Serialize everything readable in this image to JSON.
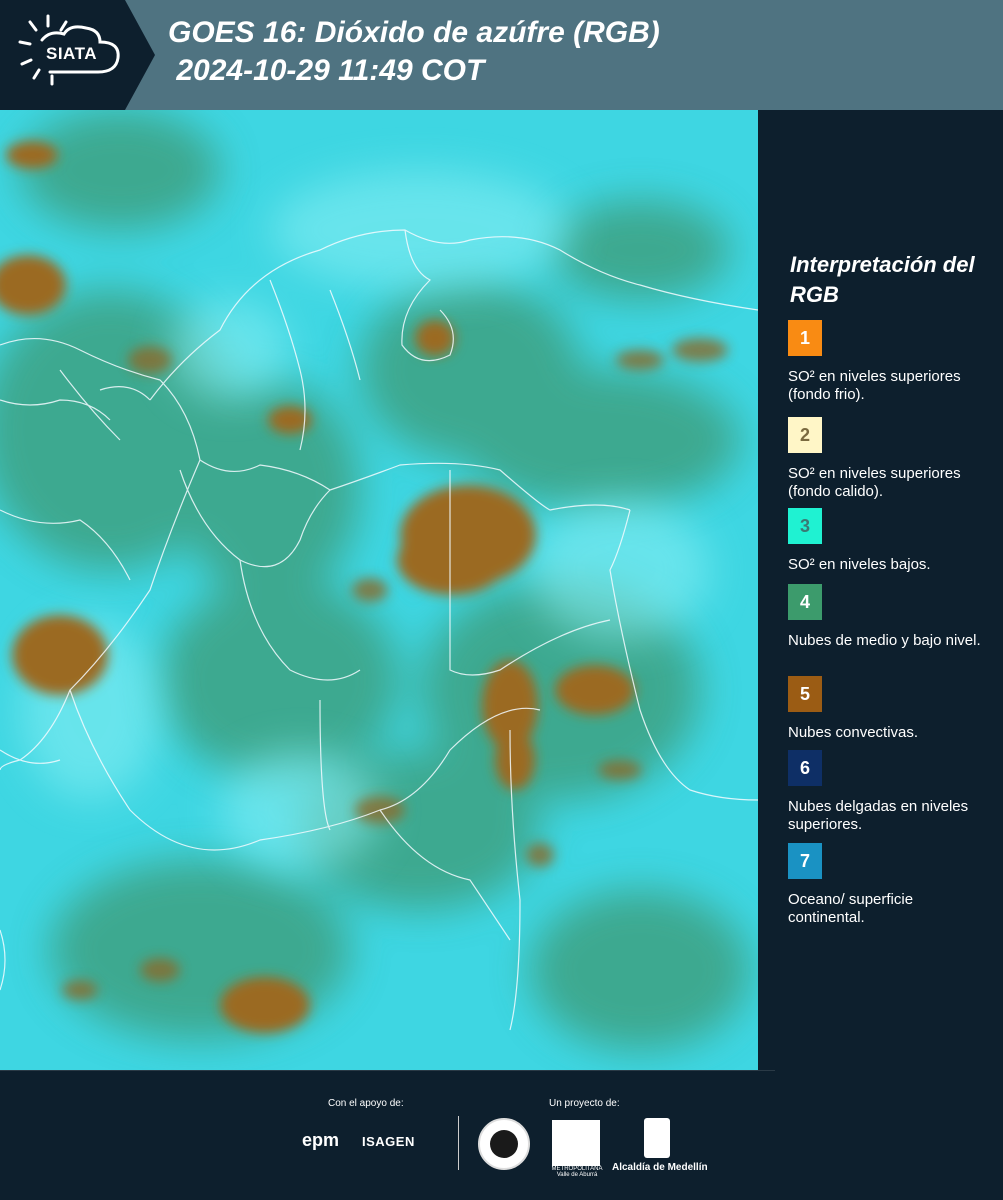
{
  "header": {
    "logo_text": "SIATA",
    "title_line1": "GOES 16: Dióxido de azúfre (RGB)",
    "title_line2": " 2024-10-29 11:49 COT"
  },
  "legend": {
    "title": "Interpretación del RGB",
    "items": [
      {
        "number": "1",
        "color": "#f98b13",
        "label": "SO² en niveles superiores (fondo frio)."
      },
      {
        "number": "2",
        "color": "#fff6c7",
        "label": "SO² en niveles superiores (fondo calido)."
      },
      {
        "number": "3",
        "color": "#1ff2d2",
        "label": "SO² en niveles bajos."
      },
      {
        "number": "4",
        "color": "#3c9b6c",
        "label": "Nubes de medio y bajo nivel."
      },
      {
        "number": "5",
        "color": "#9b5c14",
        "label": "Nubes convectivas."
      },
      {
        "number": "6",
        "color": "#0e2f66",
        "label": "Nubes delgadas en niveles superiores."
      },
      {
        "number": "7",
        "color": "#1a92c3",
        "label": "Oceano/ superficie continental."
      }
    ]
  },
  "footer": {
    "support_label": "Con el apoyo de:",
    "project_label": "Un proyecto de:",
    "epm": "epm",
    "isagen": "ISAGEN",
    "area_metropolitana": "METROPOLITANA Valle de Aburrá",
    "alcaldia": "Alcaldía de Medellín"
  },
  "colors": {
    "header_bg": "#4f7381",
    "panel_bg": "#0d1f2d",
    "cyan": "#33d7e0",
    "green": "#3c9b6c",
    "brown": "#9b6a22"
  }
}
